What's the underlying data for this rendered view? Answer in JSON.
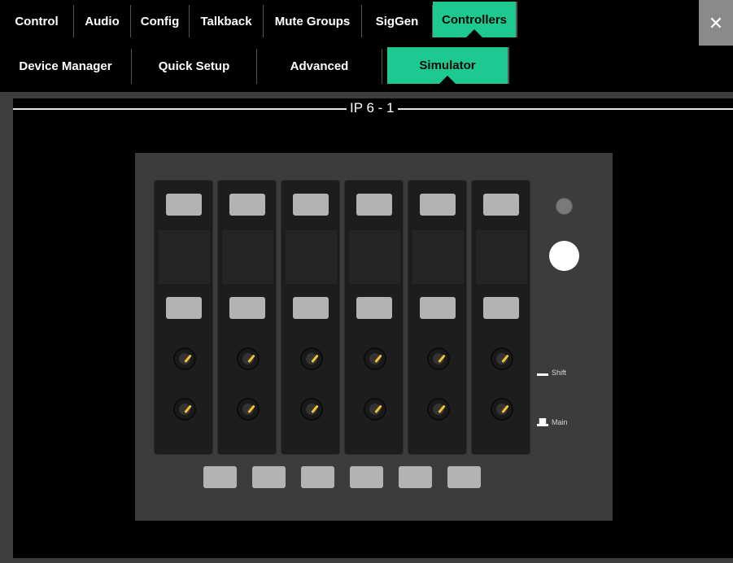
{
  "tabs_row1": [
    {
      "label": "Control",
      "active": false
    },
    {
      "label": "Audio",
      "active": false
    },
    {
      "label": "Config",
      "active": false
    },
    {
      "label": "Talkback",
      "active": false
    },
    {
      "label": "Mute Groups",
      "active": false
    },
    {
      "label": "SigGen",
      "active": false
    },
    {
      "label": "Controllers",
      "active": true
    }
  ],
  "tabs_row2": [
    {
      "label": "Device Manager",
      "active": false
    },
    {
      "label": "Quick Setup",
      "active": false
    },
    {
      "label": "Advanced",
      "active": false
    },
    {
      "label": "Simulator",
      "active": true
    }
  ],
  "close_label": "✕",
  "section_title": "IP 6 - 1",
  "controller": {
    "strip_count": 6,
    "shift_label": "Shift",
    "main_label": "Main"
  },
  "colors": {
    "accent": "#1ec891",
    "button": "#b3b3b3",
    "knob_indicator": "#f2c233"
  }
}
